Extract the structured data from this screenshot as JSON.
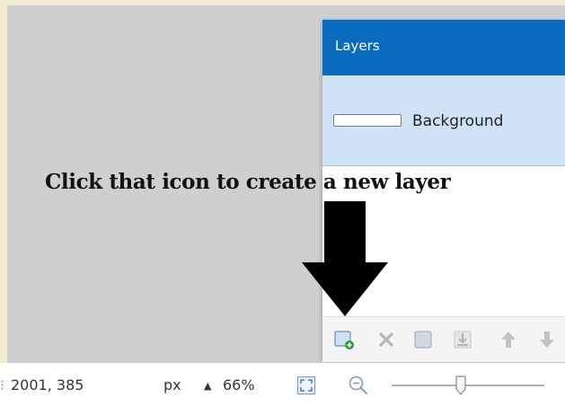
{
  "layers_panel": {
    "title": "Layers",
    "layers": [
      {
        "name": "Background",
        "selected": true
      }
    ],
    "toolbar": [
      {
        "icon": "add-layer-icon",
        "enabled": true
      },
      {
        "icon": "delete-layer-icon",
        "enabled": false
      },
      {
        "icon": "duplicate-layer-icon",
        "enabled": false
      },
      {
        "icon": "merge-layer-down-icon",
        "enabled": false
      },
      {
        "icon": "move-layer-up-icon",
        "enabled": false
      },
      {
        "icon": "move-layer-down-icon",
        "enabled": false
      }
    ]
  },
  "annotation": {
    "text": "Click that icon to create a new layer",
    "arrow": "down-arrow"
  },
  "status_bar": {
    "coordinates": "2001, 385",
    "unit": "px",
    "zoom": "66%"
  },
  "colors": {
    "panel_title_bg": "#0b6bbf",
    "selected_layer_bg": "#cfe3f5",
    "canvas_bg": "#cfcfcf",
    "page_bg": "#f2ecd0"
  }
}
